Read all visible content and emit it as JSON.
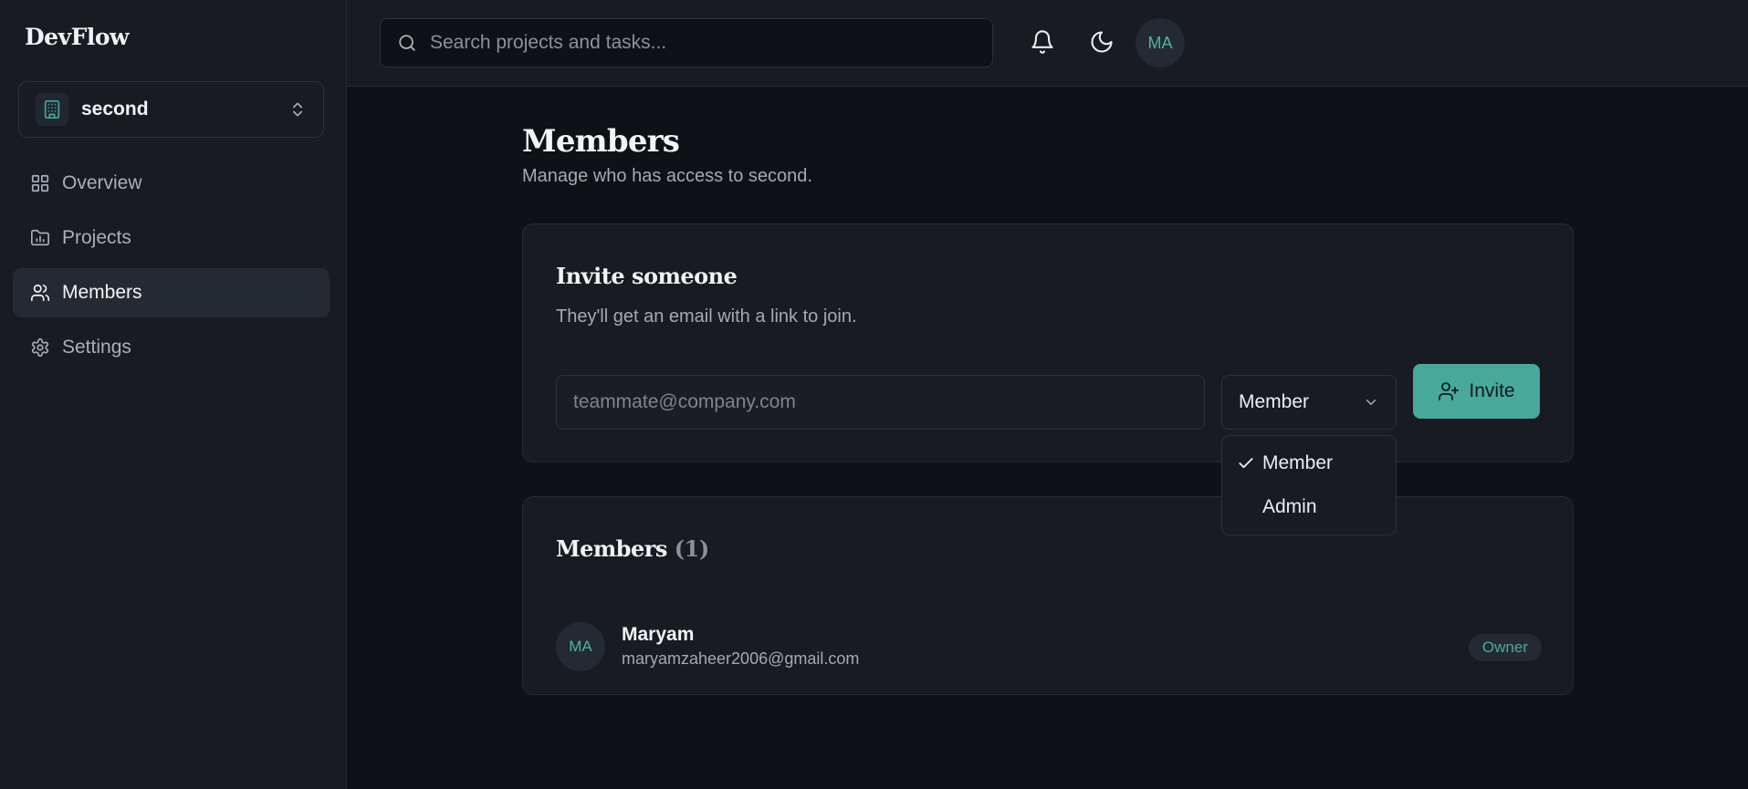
{
  "app": {
    "brand": "DevFlow"
  },
  "workspace": {
    "name": "second"
  },
  "sidebar": {
    "items": [
      {
        "label": "Overview",
        "icon": "grid-icon",
        "active": false
      },
      {
        "label": "Projects",
        "icon": "folder-chart-icon",
        "active": false
      },
      {
        "label": "Members",
        "icon": "users-icon",
        "active": true
      },
      {
        "label": "Settings",
        "icon": "gear-icon",
        "active": false
      }
    ]
  },
  "topbar": {
    "search_placeholder": "Search projects and tasks...",
    "avatar_initials": "MA"
  },
  "page": {
    "title": "Members",
    "subtitle": "Manage who has access to second."
  },
  "invite": {
    "title": "Invite someone",
    "subtitle": "They'll get an email with a link to join.",
    "email_placeholder": "teammate@company.com",
    "role_value": "Member",
    "button_label": "Invite",
    "role_options": [
      {
        "label": "Member",
        "selected": true
      },
      {
        "label": "Admin",
        "selected": false
      }
    ]
  },
  "members": {
    "title": "Members",
    "count": "(1)",
    "list": [
      {
        "initials": "MA",
        "name": "Maryam",
        "email": "maryamzaheer2006@gmail.com",
        "role": "Owner"
      }
    ]
  },
  "colors": {
    "accent": "#47a89b",
    "background": "#0e1116",
    "surface": "#181b21"
  }
}
